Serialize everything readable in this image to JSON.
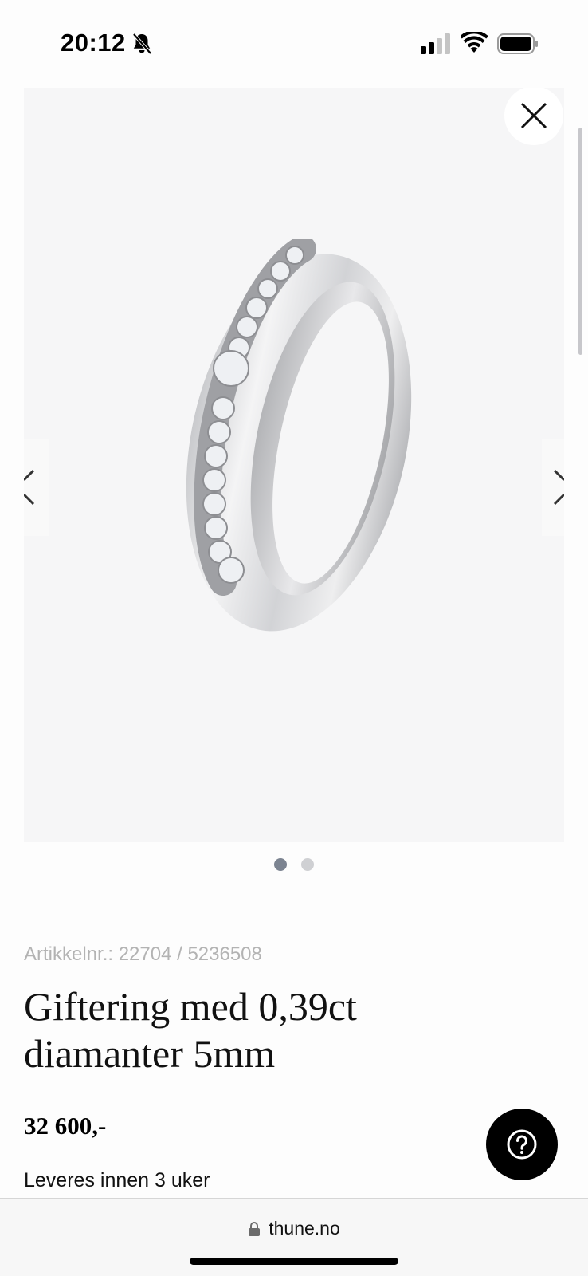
{
  "status_bar": {
    "time": "20:12",
    "icons": [
      "bell-slash-icon",
      "cellular-signal-icon",
      "wifi-icon",
      "battery-icon"
    ]
  },
  "gallery": {
    "image_alt": "Giftering med 0,39ct diamanter 5mm",
    "slide_count": 2,
    "active_slide": 1,
    "icons": [
      "close-icon",
      "chevron-left-icon",
      "chevron-right-icon"
    ]
  },
  "product": {
    "sku_label": "Artikkelnr.:",
    "sku_value": "22704 / 5236508",
    "title_line1": "Giftering med 0,39ct",
    "title_line2": "diamanter 5mm",
    "price": "32 600,-",
    "delivery": "Leveres innen 3 uker"
  },
  "help": {
    "icon": "question-circle-icon"
  },
  "browser": {
    "url": "thune.no",
    "icon": "lock-icon"
  }
}
